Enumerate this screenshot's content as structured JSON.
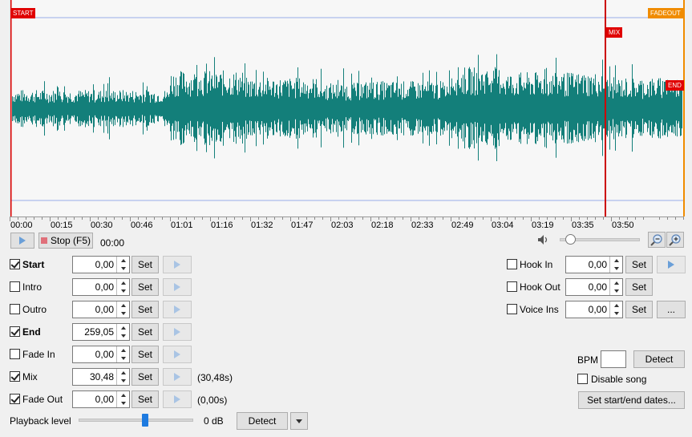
{
  "waveform": {
    "markers": {
      "start": "START",
      "fadeout": "FADEOUT",
      "mix": "MIX",
      "end": "END"
    },
    "colors": {
      "wave": "#137f7a",
      "start_line": "#dd0000",
      "mix_line": "#cc0000",
      "fadeout_line": "#f08c00",
      "guide": "#99aee8"
    }
  },
  "timeline": {
    "ticks": [
      "00:00",
      "00:15",
      "00:30",
      "00:46",
      "01:01",
      "01:16",
      "01:32",
      "01:47",
      "02:03",
      "02:18",
      "02:33",
      "02:49",
      "03:04",
      "03:19",
      "03:35",
      "03:50"
    ]
  },
  "transport": {
    "stop_label": "Stop (F5)",
    "position": "00:00"
  },
  "cues": [
    {
      "name": "Start",
      "checked": true,
      "bold": true,
      "value": "0,00",
      "set": "Set",
      "note": ""
    },
    {
      "name": "Intro",
      "checked": false,
      "bold": false,
      "value": "0,00",
      "set": "Set",
      "note": ""
    },
    {
      "name": "Outro",
      "checked": false,
      "bold": false,
      "value": "0,00",
      "set": "Set",
      "note": ""
    },
    {
      "name": "End",
      "checked": true,
      "bold": true,
      "value": "259,05",
      "set": "Set",
      "note": ""
    },
    {
      "name": "Fade In",
      "checked": false,
      "bold": false,
      "value": "0,00",
      "set": "Set",
      "note": ""
    },
    {
      "name": "Mix",
      "checked": true,
      "bold": false,
      "value": "30,48",
      "set": "Set",
      "note": "(30,48s)"
    },
    {
      "name": "Fade Out",
      "checked": true,
      "bold": false,
      "value": "0,00",
      "set": "Set",
      "note": "(0,00s)"
    }
  ],
  "hooks": [
    {
      "name": "Hook In",
      "checked": false,
      "value": "0,00",
      "set": "Set",
      "extra": "play"
    },
    {
      "name": "Hook Out",
      "checked": false,
      "value": "0,00",
      "set": "Set",
      "extra": ""
    },
    {
      "name": "Voice Ins",
      "checked": false,
      "value": "0,00",
      "set": "Set",
      "extra": "..."
    }
  ],
  "playback": {
    "label": "Playback level",
    "level": "0 dB",
    "level_fraction": 0.58,
    "detect": "Detect"
  },
  "bpm": {
    "label": "BPM",
    "value": "",
    "detect": "Detect"
  },
  "disable_song": {
    "label": "Disable song",
    "checked": false
  },
  "set_dates": {
    "label": "Set start/end dates..."
  },
  "volume": {
    "level_fraction": 0.05
  }
}
